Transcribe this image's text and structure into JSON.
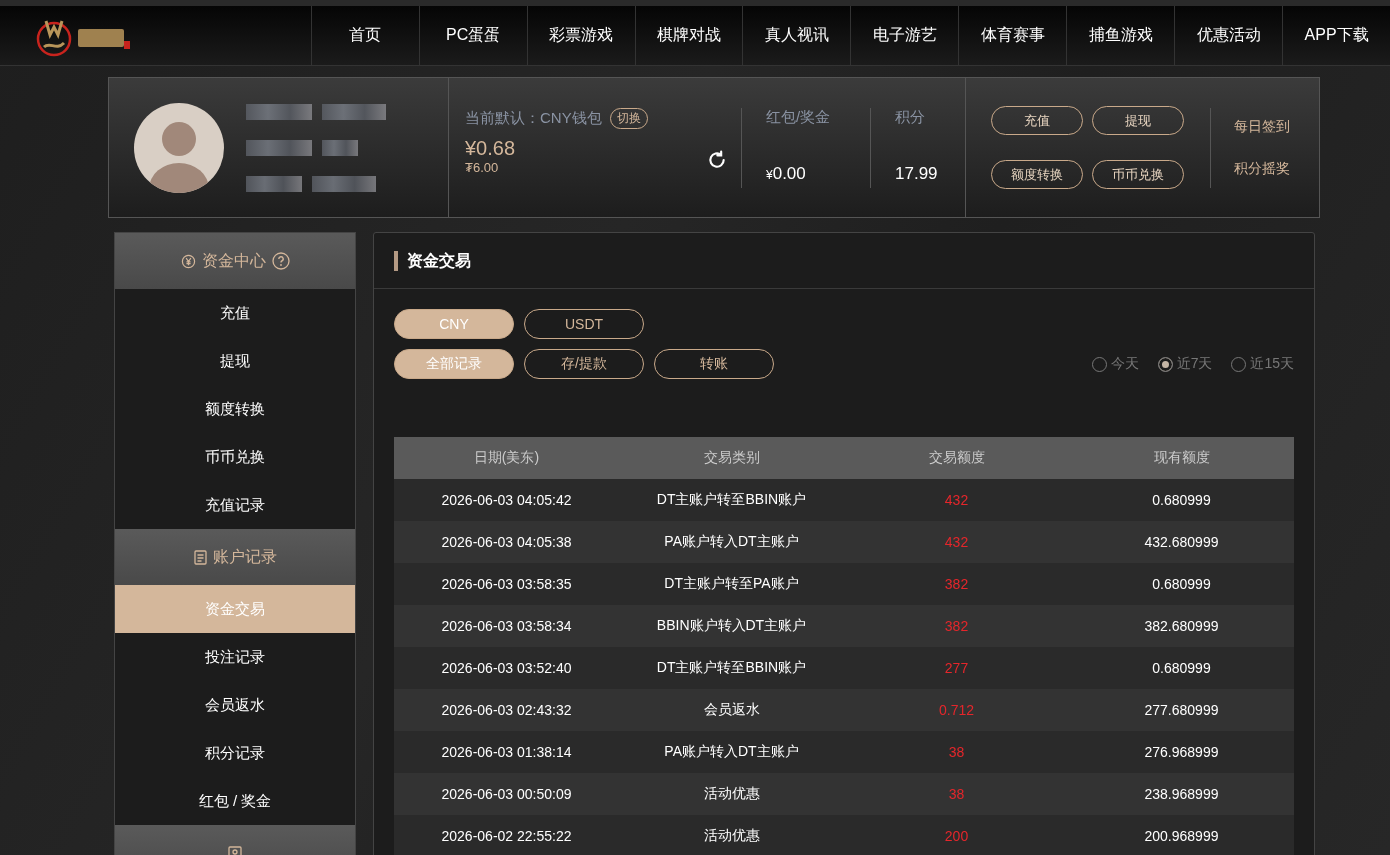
{
  "nav": {
    "items": [
      {
        "label": "首页",
        "selected": false
      },
      {
        "label": "PC蛋蛋",
        "selected": false
      },
      {
        "label": "彩票游戏",
        "selected": false
      },
      {
        "label": "棋牌对战",
        "selected": false
      },
      {
        "label": "真人视讯",
        "selected": false
      },
      {
        "label": "电子游艺",
        "selected": false
      },
      {
        "label": "体育赛事",
        "selected": false
      },
      {
        "label": "捕鱼游戏",
        "selected": false
      },
      {
        "label": "优惠活动",
        "selected": false
      },
      {
        "label": "APP下载",
        "selected": false
      }
    ]
  },
  "profile": {
    "wallet_label": "当前默认：CNY钱包",
    "switch_button": "切换",
    "balance": "¥0.68",
    "sub_balance": "₮6.00",
    "bonus": {
      "label": "红包/奖金",
      "currency": "¥",
      "value": "0.00"
    },
    "points": {
      "label": "积分",
      "value": "17.99"
    },
    "actions": [
      "充值",
      "提现",
      "额度转换",
      "币币兑换"
    ],
    "links": [
      "每日签到",
      "积分摇奖"
    ]
  },
  "sidebar": {
    "sections": [
      {
        "title": "资金中心",
        "kind": "yen",
        "help": true,
        "items": [
          {
            "label": "充值",
            "selected": false
          },
          {
            "label": "提现",
            "selected": false
          },
          {
            "label": "额度转换",
            "selected": false
          },
          {
            "label": "币币兑换",
            "selected": false
          },
          {
            "label": "充值记录",
            "selected": false
          }
        ]
      },
      {
        "title": "账户记录",
        "kind": "record",
        "help": false,
        "items": [
          {
            "label": "资金交易",
            "selected": true
          },
          {
            "label": "投注记录",
            "selected": false
          },
          {
            "label": "会员返水",
            "selected": false
          },
          {
            "label": "积分记录",
            "selected": false
          },
          {
            "label": "红包 / 奖金",
            "selected": false
          }
        ]
      },
      {
        "kind": "user",
        "help": false
      }
    ]
  },
  "panel": {
    "title": "资金交易",
    "currency_tabs": [
      {
        "label": "CNY",
        "selected": true
      },
      {
        "label": "USDT",
        "selected": false
      }
    ],
    "type_tabs": [
      {
        "label": "全部记录",
        "selected": true
      },
      {
        "label": "存/提款",
        "selected": false
      },
      {
        "label": "转账",
        "selected": false
      }
    ],
    "ranges": [
      {
        "label": "今天",
        "selected": false
      },
      {
        "label": "近7天",
        "selected": true
      },
      {
        "label": "近15天",
        "selected": false
      }
    ],
    "table": {
      "columns": [
        "日期(美东)",
        "交易类别",
        "交易额度",
        "现有额度"
      ],
      "rows": [
        [
          "2026-06-03 04:05:42",
          "DT主账户转至BBIN账户",
          "432",
          "0.680999"
        ],
        [
          "2026-06-03 04:05:38",
          "PA账户转入DT主账户",
          "432",
          "432.680999"
        ],
        [
          "2026-06-03 03:58:35",
          "DT主账户转至PA账户",
          "382",
          "0.680999"
        ],
        [
          "2026-06-03 03:58:34",
          "BBIN账户转入DT主账户",
          "382",
          "382.680999"
        ],
        [
          "2026-06-03 03:52:40",
          "DT主账户转至BBIN账户",
          "277",
          "0.680999"
        ],
        [
          "2026-06-03 02:43:32",
          "会员返水",
          "0.712",
          "277.680999"
        ],
        [
          "2026-06-03 01:38:14",
          "PA账户转入DT主账户",
          "38",
          "276.968999"
        ],
        [
          "2026-06-03 00:50:09",
          "活动优惠",
          "38",
          "238.968999"
        ],
        [
          "2026-06-02 22:55:22",
          "活动优惠",
          "200",
          "200.968999"
        ]
      ]
    }
  }
}
